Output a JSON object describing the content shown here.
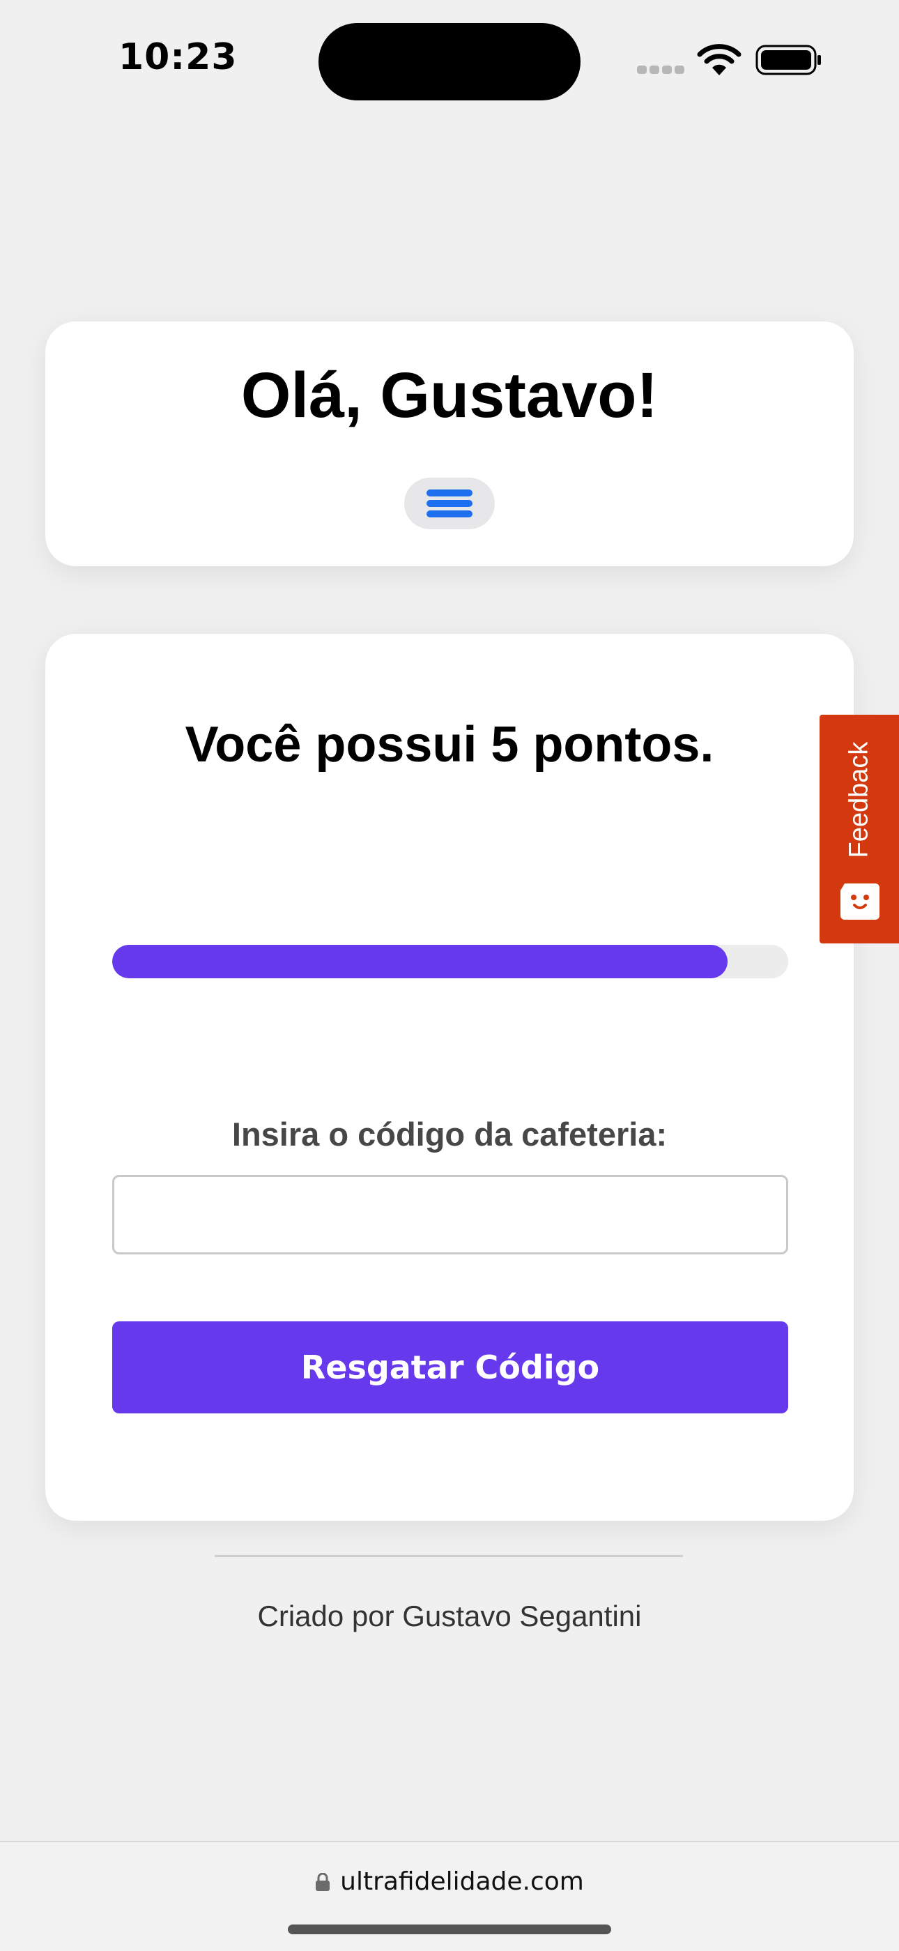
{
  "status_bar": {
    "time": "10:23"
  },
  "header": {
    "greeting": "Olá, Gustavo!",
    "menu_icon": "hamburger-menu-icon"
  },
  "points": {
    "message": "Você possui 5 pontos.",
    "progress_fraction": 0.91
  },
  "redeem": {
    "label": "Insira o código da cafeteria:",
    "input_value": "",
    "placeholder": "",
    "button_label": "Resgatar Código"
  },
  "footer": {
    "credit": "Criado por Gustavo Segantini"
  },
  "feedback": {
    "label": "Feedback"
  },
  "browser": {
    "url": "ultrafidelidade.com"
  },
  "colors": {
    "accent": "#6639ec",
    "menu_icon": "#1e6ff0",
    "feedback": "#d3380f",
    "background": "#f0f0f0"
  }
}
